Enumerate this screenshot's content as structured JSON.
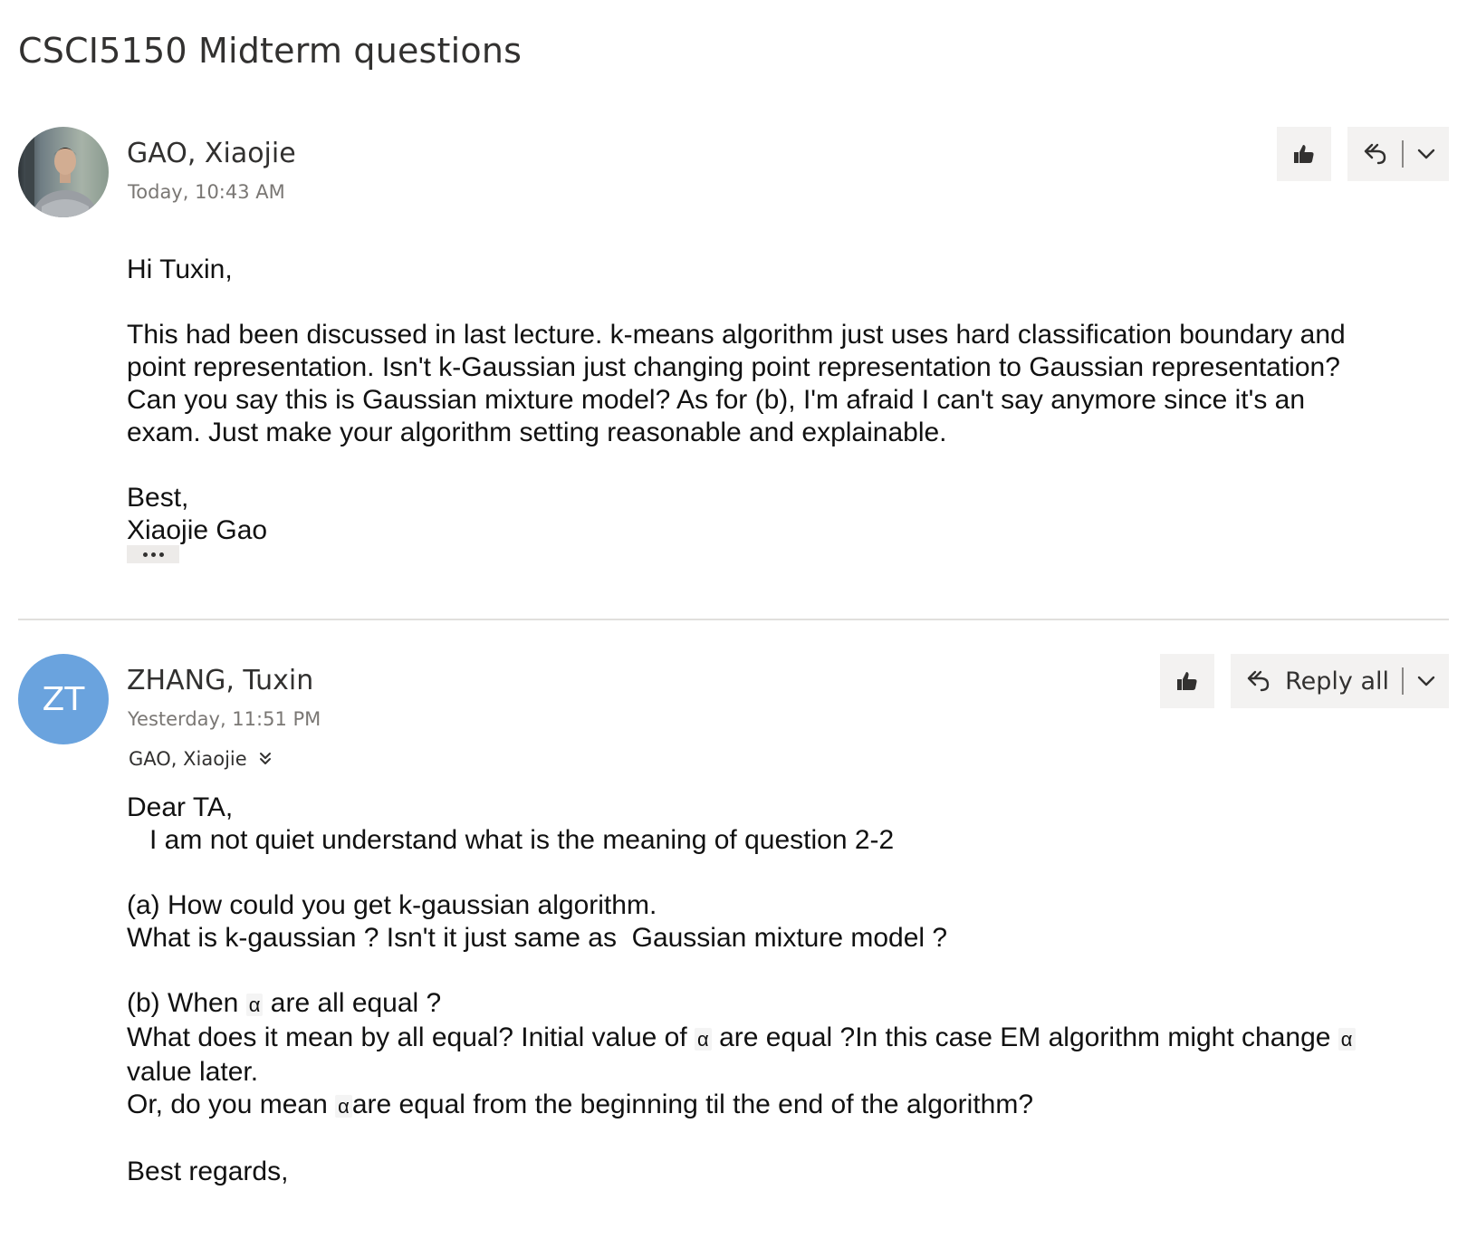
{
  "thread": {
    "title": "CSCI5150 Midterm questions"
  },
  "messages": [
    {
      "sender": "GAO, Xiaojie",
      "timestamp": "Today, 10:43 AM",
      "avatar_icon": "person-photo",
      "body": {
        "greeting": "Hi Tuxin,",
        "paragraph_lines": [
          "This had been discussed in last lecture. k-means algorithm just uses hard classification boundary and",
          "point representation. Isn't k-Gaussian just changing point representation to Gaussian representation?",
          "Can you say this is Gaussian mixture model? As for (b), I'm afraid I can't say anymore since it's an",
          "exam. Just make your algorithm setting reasonable and explainable."
        ],
        "closing": "Best,",
        "signature": "Xiaojie Gao"
      }
    },
    {
      "sender": "ZHANG, Tuxin",
      "initials": "ZT",
      "avatar_color": "#6aa3de",
      "timestamp": "Yesterday, 11:51 PM",
      "recipient": "GAO, Xiaojie",
      "reply_all_label": "Reply all",
      "body": {
        "greeting": "Dear TA,",
        "intro": "   I am not quiet understand what is the meaning of question 2-2",
        "part_a_line1": "(a) How could you get k-gaussian algorithm.",
        "part_a_line2": "What is k-gaussian ? Isn't it just same as  Gaussian mixture model ?",
        "alpha": "α",
        "part_b_l1_pre": "(b) When ",
        "part_b_l1_post": " are all equal ?",
        "part_b_l2_pre": "What does it mean by all equal? Initial value of ",
        "part_b_l2_mid": " are equal ?In this case EM algorithm might change ",
        "part_b_l3": "value later.",
        "part_b_l4_pre": "Or, do you mean ",
        "part_b_l4_post": "are equal from the beginning til the end of the algorithm?",
        "closing": "Best regards,"
      }
    }
  ],
  "colors": {
    "button_bg": "#f3f2f1",
    "divider": "#e1dfdd",
    "avatar_zt": "#6aa3de"
  }
}
